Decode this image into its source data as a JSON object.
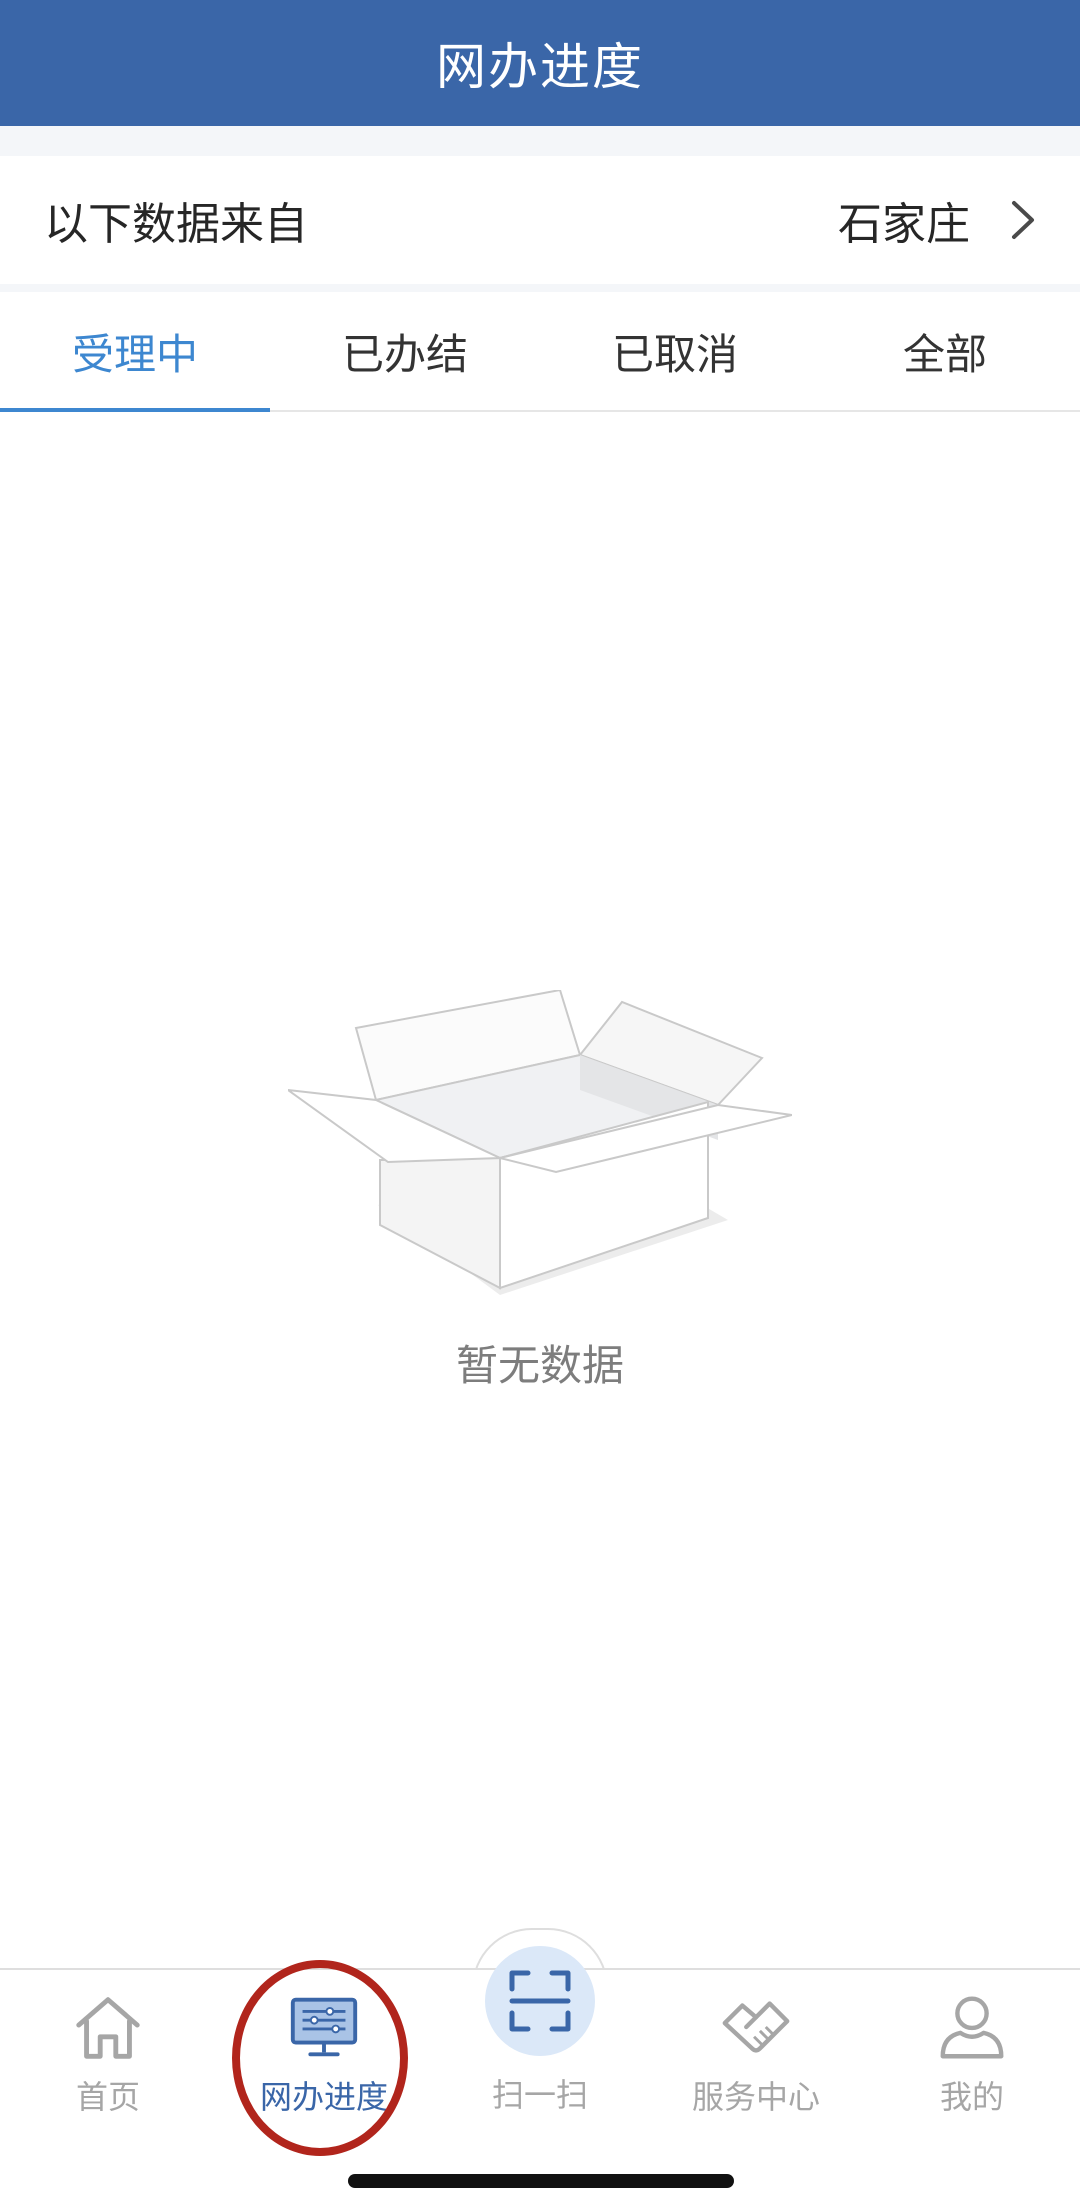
{
  "header": {
    "title": "网办进度"
  },
  "source": {
    "label": "以下数据来自",
    "city": "石家庄"
  },
  "tabs": [
    {
      "label": "受理中",
      "active": true
    },
    {
      "label": "已办结",
      "active": false
    },
    {
      "label": "已取消",
      "active": false
    },
    {
      "label": "全部",
      "active": false
    }
  ],
  "empty_state": {
    "text": "暂无数据"
  },
  "bottom_nav": [
    {
      "label": "首页",
      "icon": "home-icon",
      "active": false
    },
    {
      "label": "网办进度",
      "icon": "monitor-progress-icon",
      "active": true
    },
    {
      "label": "扫一扫",
      "icon": "scan-icon",
      "active": false
    },
    {
      "label": "服务中心",
      "icon": "handshake-icon",
      "active": false
    },
    {
      "label": "我的",
      "icon": "user-icon",
      "active": false
    }
  ],
  "colors": {
    "header_bg": "#3a66a8",
    "tab_active": "#3d87d0",
    "nav_active": "#3a66a8",
    "nav_inactive": "#a6a6a6",
    "highlight_ring": "#b1251c"
  }
}
